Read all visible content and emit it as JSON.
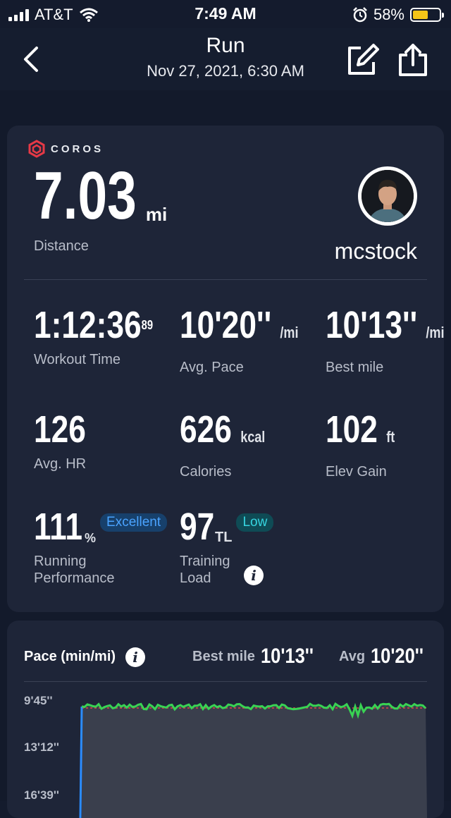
{
  "status": {
    "carrier": "AT&T",
    "time": "7:49 AM",
    "battery_pct": "58%",
    "battery_level": 0.58,
    "icons": [
      "signal-icon",
      "wifi-icon",
      "alarm-icon",
      "battery-icon"
    ]
  },
  "header": {
    "title": "Run",
    "subtitle": "Nov 27, 2021, 6:30 AM",
    "icons": [
      "back-arrow-icon",
      "edit-icon",
      "share-icon"
    ]
  },
  "summary": {
    "brand": "COROS",
    "distance": {
      "value": "7.03",
      "unit": "mi",
      "label": "Distance"
    },
    "user": {
      "name": "mcstock"
    },
    "metrics": {
      "workout_time": {
        "value": "1:12:36",
        "sup": "89",
        "label": "Workout Time"
      },
      "avg_pace": {
        "value": "10'20''",
        "unit": "/mi",
        "label": "Avg. Pace"
      },
      "best_mile": {
        "value": "10'13''",
        "unit": "/mi",
        "label": "Best mile"
      },
      "avg_hr": {
        "value": "126",
        "label": "Avg. HR"
      },
      "calories": {
        "value": "626",
        "unit": "kcal",
        "label": "Calories"
      },
      "elev_gain": {
        "value": "102",
        "unit": "ft",
        "label": "Elev Gain"
      },
      "running_performance": {
        "value": "111",
        "unit": "%",
        "badge": "Excellent",
        "label_1": "Running",
        "label_2": "Performance"
      },
      "training_load": {
        "value": "97",
        "unit": "TL",
        "badge": "Low",
        "label_1": "Training",
        "label_2": "Load"
      }
    }
  },
  "pace_chart": {
    "title": "Pace (min/mi)",
    "best_label": "Best mile",
    "best_value": "10'13''",
    "avg_label": "Avg",
    "avg_value": "10'20''",
    "y_ticks": [
      "9'45''",
      "13'12''",
      "16'39''"
    ],
    "colors": {
      "line": "#39d353",
      "fill": "#3a3f4d",
      "avg_line": "#e0434b",
      "start": "#2b8cff"
    }
  }
}
